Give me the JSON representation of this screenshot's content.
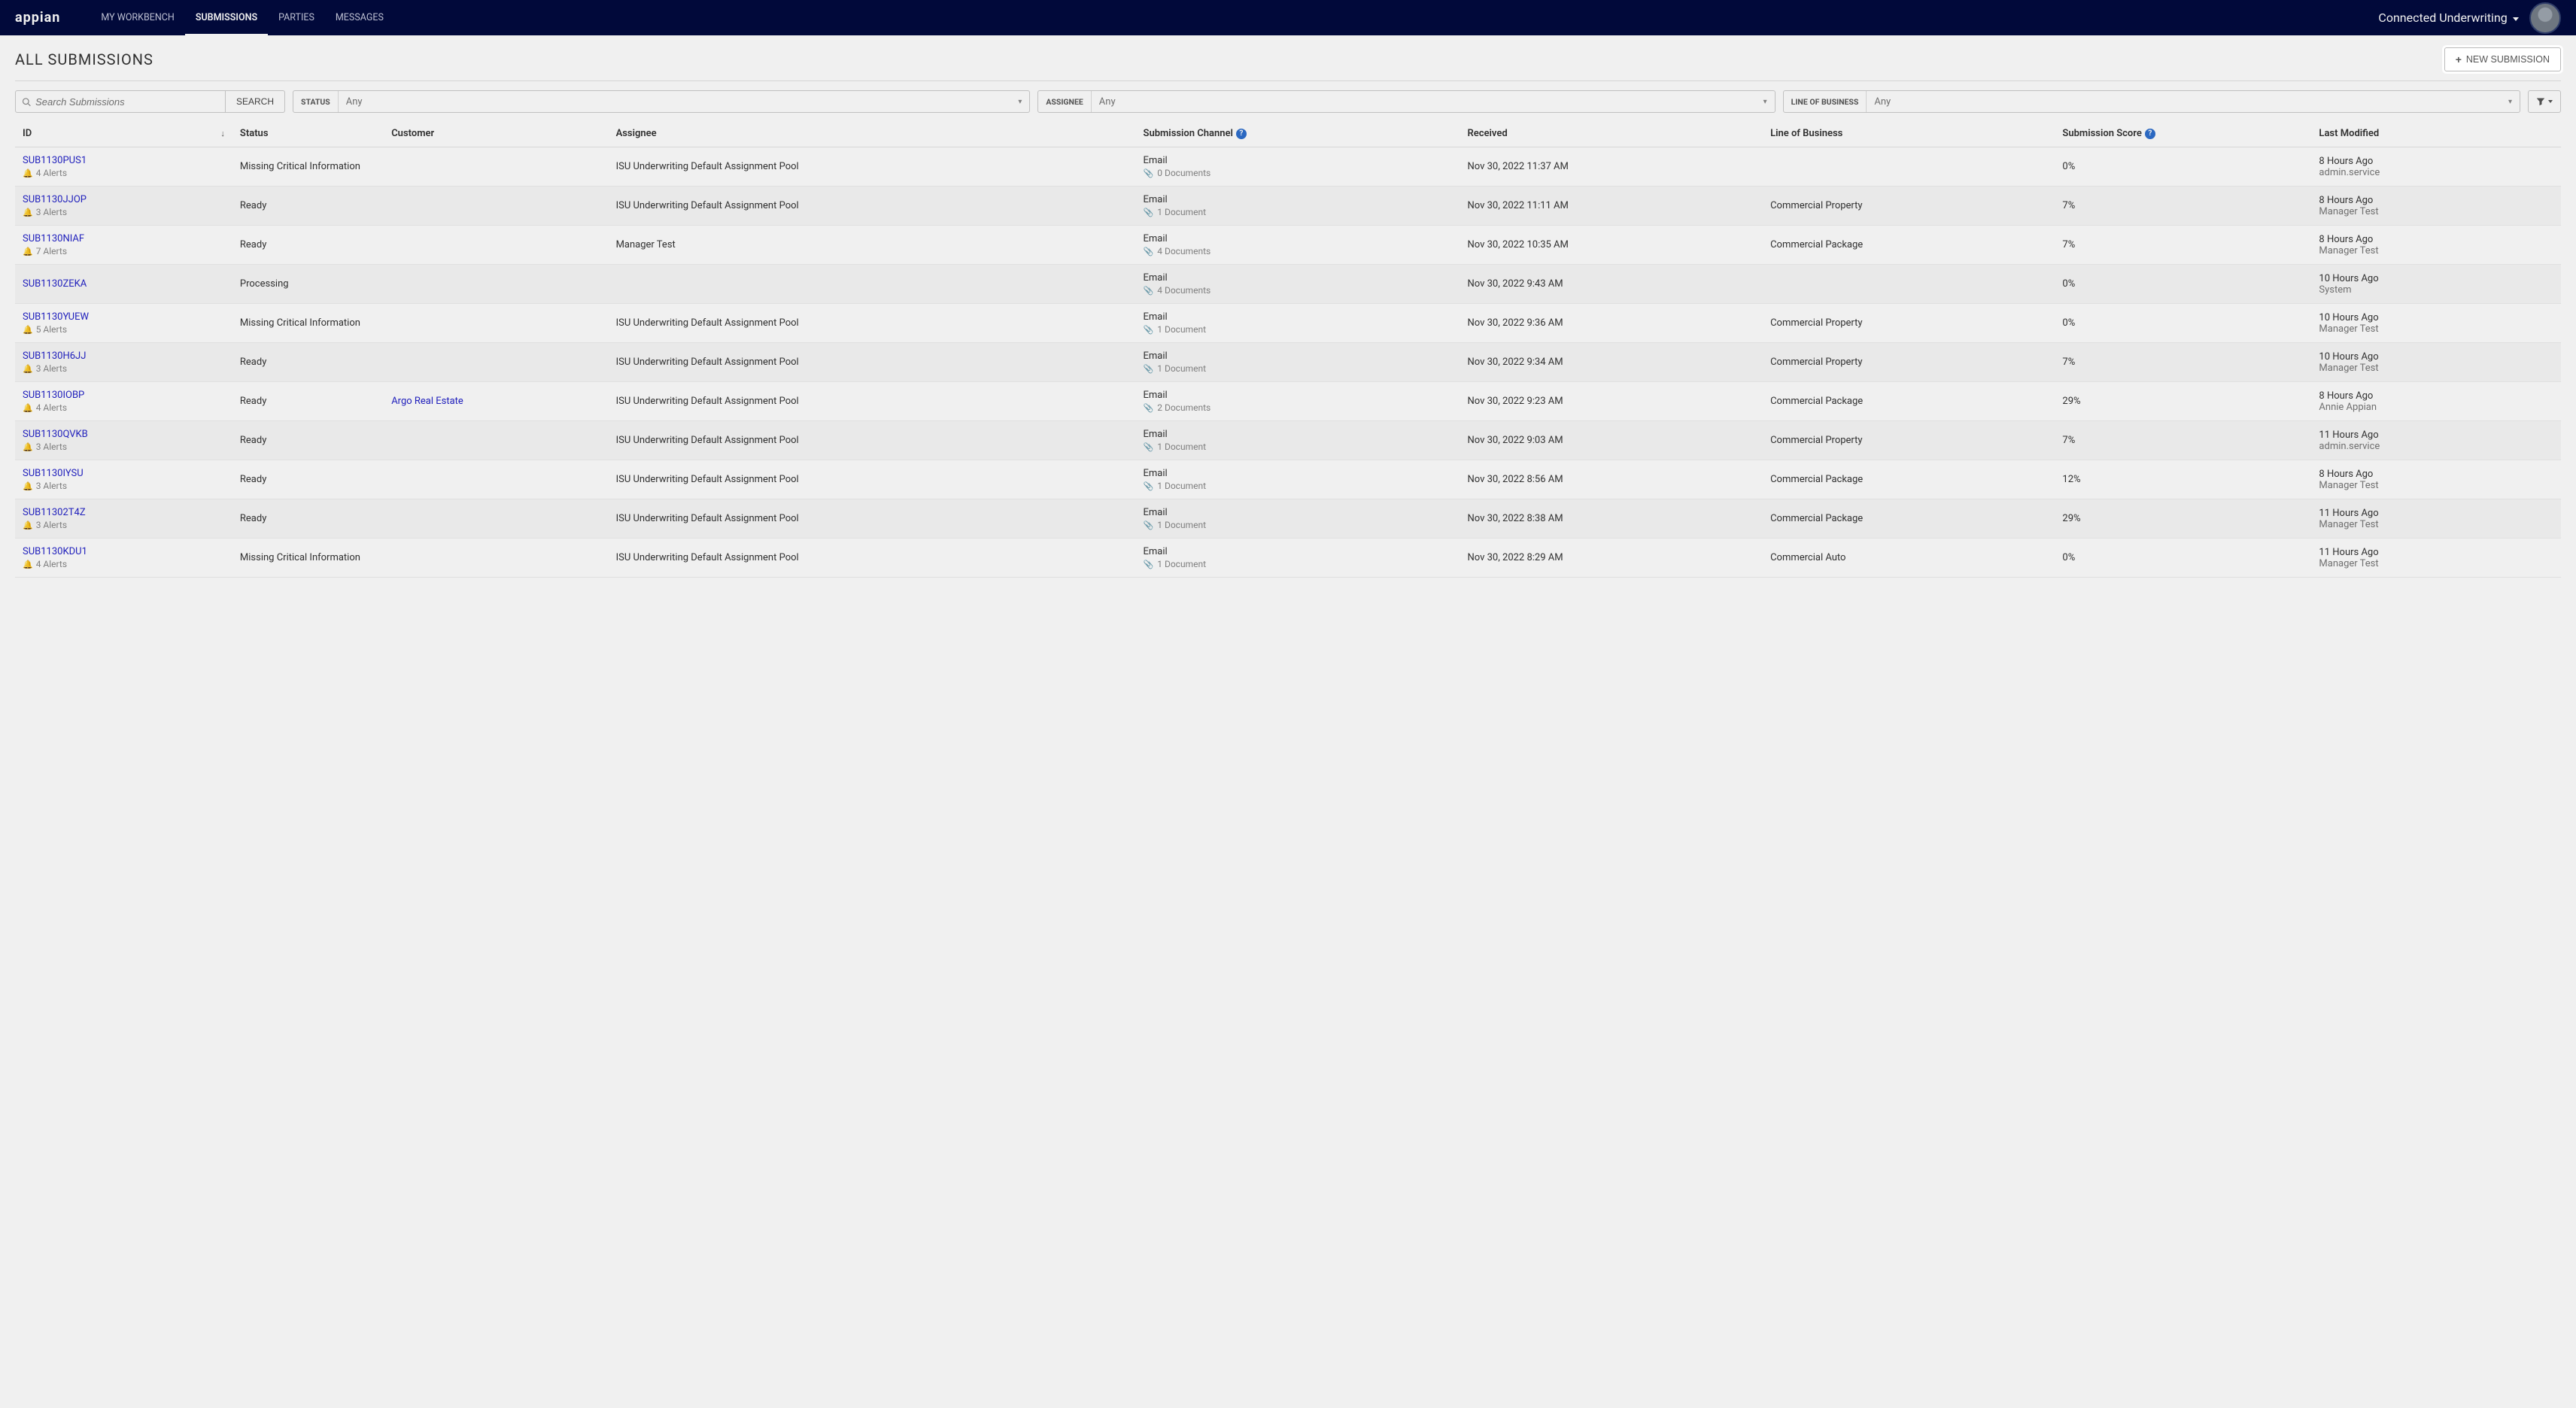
{
  "nav": {
    "logo": "appian",
    "items": [
      {
        "label": "MY WORKBENCH",
        "active": false
      },
      {
        "label": "SUBMISSIONS",
        "active": true
      },
      {
        "label": "PARTIES",
        "active": false
      },
      {
        "label": "MESSAGES",
        "active": false
      }
    ],
    "site_name": "Connected Underwriting"
  },
  "page": {
    "title": "ALL SUBMISSIONS",
    "new_submission_label": "NEW SUBMISSION"
  },
  "filters": {
    "search_placeholder": "Search Submissions",
    "search_button": "SEARCH",
    "status": {
      "label": "STATUS",
      "value": "Any"
    },
    "assignee": {
      "label": "ASSIGNEE",
      "value": "Any"
    },
    "lob": {
      "label": "LINE OF BUSINESS",
      "value": "Any"
    }
  },
  "columns": {
    "id": "ID",
    "status": "Status",
    "customer": "Customer",
    "assignee": "Assignee",
    "channel": "Submission Channel",
    "received": "Received",
    "lob": "Line of Business",
    "score": "Submission Score",
    "modified": "Last Modified"
  },
  "rows": [
    {
      "id": "SUB1130PUS1",
      "alerts": "4 Alerts",
      "status": "Missing Critical Information",
      "customer": "",
      "assignee": "ISU Underwriting Default Assignment Pool",
      "channel": "Email",
      "docs": "0 Documents",
      "received": "Nov 30, 2022 11:37 AM",
      "lob": "",
      "score": "0%",
      "mod1": "8 Hours Ago",
      "mod2": "admin.service"
    },
    {
      "id": "SUB1130JJOP",
      "alerts": "3 Alerts",
      "status": "Ready",
      "customer": "",
      "assignee": "ISU Underwriting Default Assignment Pool",
      "channel": "Email",
      "docs": "1 Document",
      "received": "Nov 30, 2022 11:11 AM",
      "lob": "Commercial Property",
      "score": "7%",
      "mod1": "8 Hours Ago",
      "mod2": "Manager Test"
    },
    {
      "id": "SUB1130NIAF",
      "alerts": "7 Alerts",
      "status": "Ready",
      "customer": "",
      "assignee": "Manager Test",
      "channel": "Email",
      "docs": "4 Documents",
      "received": "Nov 30, 2022 10:35 AM",
      "lob": "Commercial Package",
      "score": "7%",
      "mod1": "8 Hours Ago",
      "mod2": "Manager Test"
    },
    {
      "id": "SUB1130ZEKA",
      "alerts": "",
      "status": "Processing",
      "customer": "",
      "assignee": "",
      "channel": "Email",
      "docs": "4 Documents",
      "received": "Nov 30, 2022 9:43 AM",
      "lob": "",
      "score": "0%",
      "mod1": "10 Hours Ago",
      "mod2": "System"
    },
    {
      "id": "SUB1130YUEW",
      "alerts": "5 Alerts",
      "status": "Missing Critical Information",
      "customer": "",
      "assignee": "ISU Underwriting Default Assignment Pool",
      "channel": "Email",
      "docs": "1 Document",
      "received": "Nov 30, 2022 9:36 AM",
      "lob": "Commercial Property",
      "score": "0%",
      "mod1": "10 Hours Ago",
      "mod2": "Manager Test"
    },
    {
      "id": "SUB1130H6JJ",
      "alerts": "3 Alerts",
      "status": "Ready",
      "customer": "",
      "assignee": "ISU Underwriting Default Assignment Pool",
      "channel": "Email",
      "docs": "1 Document",
      "received": "Nov 30, 2022 9:34 AM",
      "lob": "Commercial Property",
      "score": "7%",
      "mod1": "10 Hours Ago",
      "mod2": "Manager Test"
    },
    {
      "id": "SUB1130IOBP",
      "alerts": "4 Alerts",
      "status": "Ready",
      "customer": "Argo Real Estate",
      "assignee": "ISU Underwriting Default Assignment Pool",
      "channel": "Email",
      "docs": "2 Documents",
      "received": "Nov 30, 2022 9:23 AM",
      "lob": "Commercial Package",
      "score": "29%",
      "mod1": "8 Hours Ago",
      "mod2": "Annie Appian"
    },
    {
      "id": "SUB1130QVKB",
      "alerts": "3 Alerts",
      "status": "Ready",
      "customer": "",
      "assignee": "ISU Underwriting Default Assignment Pool",
      "channel": "Email",
      "docs": "1 Document",
      "received": "Nov 30, 2022 9:03 AM",
      "lob": "Commercial Property",
      "score": "7%",
      "mod1": "11 Hours Ago",
      "mod2": "admin.service"
    },
    {
      "id": "SUB1130IYSU",
      "alerts": "3 Alerts",
      "status": "Ready",
      "customer": "",
      "assignee": "ISU Underwriting Default Assignment Pool",
      "channel": "Email",
      "docs": "1 Document",
      "received": "Nov 30, 2022 8:56 AM",
      "lob": "Commercial Package",
      "score": "12%",
      "mod1": "8 Hours Ago",
      "mod2": "Manager Test"
    },
    {
      "id": "SUB11302T4Z",
      "alerts": "3 Alerts",
      "status": "Ready",
      "customer": "",
      "assignee": "ISU Underwriting Default Assignment Pool",
      "channel": "Email",
      "docs": "1 Document",
      "received": "Nov 30, 2022 8:38 AM",
      "lob": "Commercial Package",
      "score": "29%",
      "mod1": "11 Hours Ago",
      "mod2": "Manager Test"
    },
    {
      "id": "SUB1130KDU1",
      "alerts": "4 Alerts",
      "status": "Missing Critical Information",
      "customer": "",
      "assignee": "ISU Underwriting Default Assignment Pool",
      "channel": "Email",
      "docs": "1 Document",
      "received": "Nov 30, 2022 8:29 AM",
      "lob": "Commercial Auto",
      "score": "0%",
      "mod1": "11 Hours Ago",
      "mod2": "Manager Test"
    }
  ]
}
